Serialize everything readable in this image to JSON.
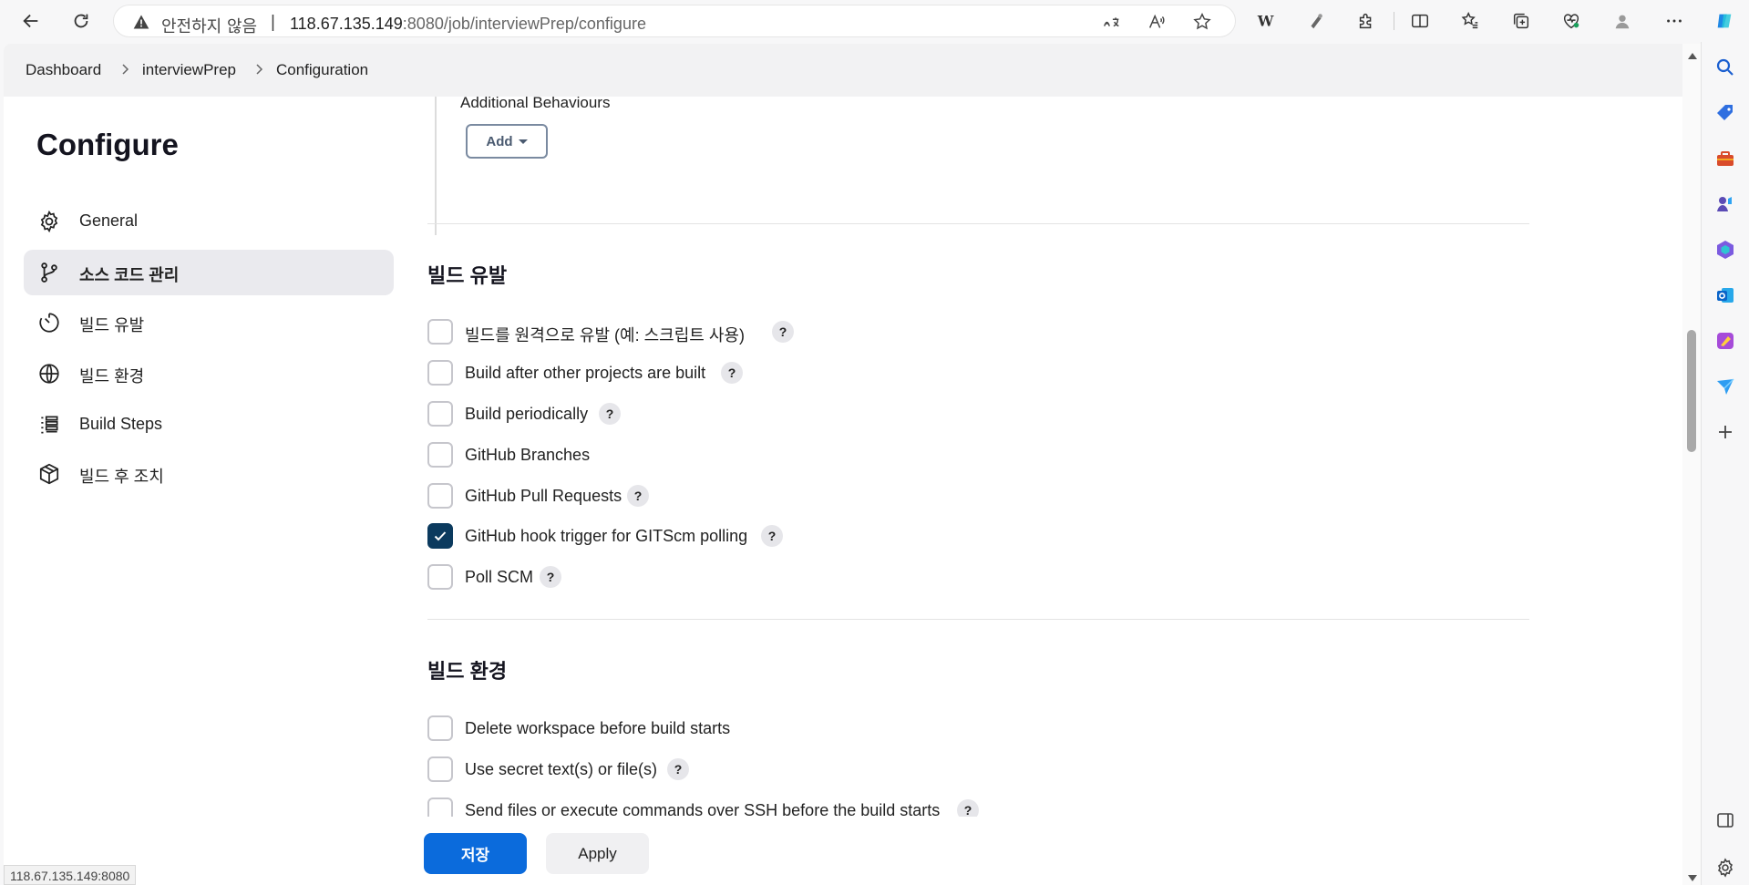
{
  "browser": {
    "security_label": "안전하지 않음",
    "separator": "|",
    "url_host": "118.67.135.149",
    "url_rest": ":8080/job/interviewPrep/configure"
  },
  "breadcrumb": {
    "items": [
      "Dashboard",
      "interviewPrep",
      "Configuration"
    ]
  },
  "sidebar": {
    "title": "Configure",
    "items": [
      {
        "label": "General",
        "icon": "gear-icon"
      },
      {
        "label": "소스 코드 관리",
        "icon": "branch-icon"
      },
      {
        "label": "빌드 유발",
        "icon": "timer-icon"
      },
      {
        "label": "빌드 환경",
        "icon": "globe-icon"
      },
      {
        "label": "Build Steps",
        "icon": "list-icon"
      },
      {
        "label": "빌드 후 조치",
        "icon": "package-icon"
      }
    ]
  },
  "scm": {
    "additional_behaviours_label": "Additional Behaviours",
    "add_button_label": "Add"
  },
  "triggers": {
    "title": "빌드 유발",
    "options": [
      {
        "label": "빌드를 원격으로 유발 (예: 스크립트 사용)",
        "checked": false,
        "help": "?"
      },
      {
        "label": "Build after other projects are built",
        "checked": false,
        "help": "?"
      },
      {
        "label": "Build periodically",
        "checked": false,
        "help": "?"
      },
      {
        "label": "GitHub Branches",
        "checked": false,
        "help": ""
      },
      {
        "label": "GitHub Pull Requests",
        "checked": false,
        "help": "?"
      },
      {
        "label": "GitHub hook trigger for GITScm polling",
        "checked": true,
        "help": "?"
      },
      {
        "label": "Poll SCM",
        "checked": false,
        "help": "?"
      }
    ]
  },
  "build_env": {
    "title": "빌드 환경",
    "options": [
      {
        "label": "Delete workspace before build starts",
        "checked": false,
        "help": ""
      },
      {
        "label": "Use secret text(s) or file(s)",
        "checked": false,
        "help": "?"
      },
      {
        "label": "Send files or execute commands over SSH before the build starts",
        "checked": false,
        "help": "?"
      }
    ]
  },
  "actions": {
    "save_label": "저장",
    "apply_label": "Apply"
  },
  "status_bar": {
    "url": "118.67.135.149:8080"
  },
  "colors": {
    "primary": "#0b6bdc",
    "checked": "#0b3a5e"
  }
}
